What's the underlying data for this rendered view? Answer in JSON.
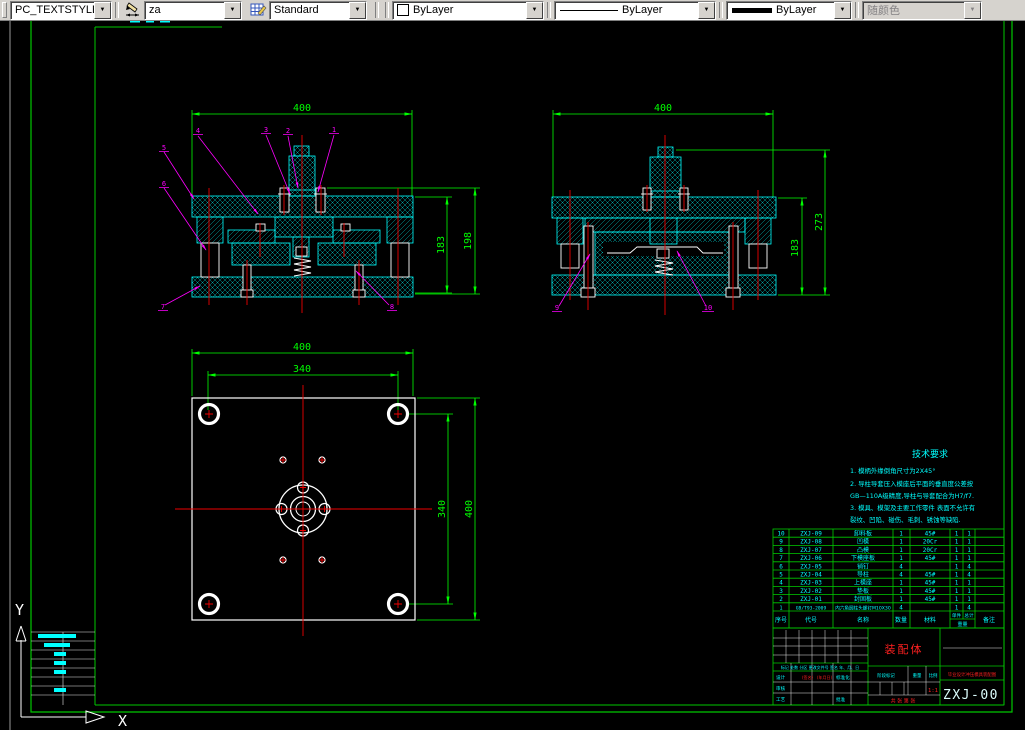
{
  "toolbar": {
    "text_style": {
      "value": "PC_TEXTSTYLE"
    },
    "dim_style": {
      "value": "za"
    },
    "table_style": {
      "value": "Standard"
    },
    "color": {
      "value": "ByLayer",
      "swatch": "#ffffff"
    },
    "linetype": {
      "value": "ByLayer"
    },
    "lineweight": {
      "value": "ByLayer"
    },
    "plot_style": {
      "value": "随颜色",
      "disabled": true
    },
    "arrow_glyph": "▼"
  },
  "ucs": {
    "x_label": "X",
    "y_label": "Y"
  },
  "colors": {
    "dim": "#00ff00",
    "geometry": "#00ffff",
    "center": "#ee0000",
    "leader": "#ff00ff",
    "table": "#00cc00",
    "title_red": "#ff2020"
  },
  "views": {
    "section_open": {
      "dim_top": "400",
      "dim_right_inner": "183",
      "dim_right_outer": "198",
      "leaders": [
        "1",
        "2",
        "3",
        "4",
        "5",
        "6",
        "7",
        "8"
      ]
    },
    "section_closed": {
      "dim_top": "400",
      "dim_right_inner": "183",
      "dim_right_outer": "273",
      "leaders": [
        "9",
        "10"
      ]
    },
    "plan": {
      "dim_top_outer": "400",
      "dim_top_inner": "340",
      "dim_right_inner": "340",
      "dim_right_outer": "400"
    }
  },
  "tech_requirements": {
    "title": "技术要求",
    "lines": [
      "1. 模柄外缘倒角尺寸为2X45°",
      "2. 导柱导套压入模座后平面的垂直度公差按",
      "   GB—110A级精度,导柱与导套配合为H7/f7.",
      "3. 模具、模架及主要工作零件 表面不允许有",
      "   裂纹、凹陷、碰伤、毛刺、锈蚀等缺陷."
    ]
  },
  "bom": {
    "headers": {
      "seq": "序号",
      "code": "代号",
      "name": "名称",
      "qty": "数量",
      "material": "材料",
      "weight": "重量",
      "unit": "单件",
      "total": "总计",
      "notes": "备注"
    },
    "rows": [
      {
        "seq": "10",
        "code": "ZXJ-09",
        "name": "卸料板",
        "qty": "1",
        "material": "45#",
        "unit": "1",
        "total": "1",
        "notes": ""
      },
      {
        "seq": "9",
        "code": "ZXJ-08",
        "name": "凹模",
        "qty": "1",
        "material": "20Cr",
        "unit": "1",
        "total": "1",
        "notes": ""
      },
      {
        "seq": "8",
        "code": "ZXJ-07",
        "name": "凸模",
        "qty": "1",
        "material": "20Cr",
        "unit": "1",
        "total": "1",
        "notes": ""
      },
      {
        "seq": "7",
        "code": "ZXJ-06",
        "name": "下模座板",
        "qty": "1",
        "material": "45#",
        "unit": "1",
        "total": "1",
        "notes": ""
      },
      {
        "seq": "6",
        "code": "ZXJ-05",
        "name": "销钉",
        "qty": "4",
        "material": "",
        "unit": "1",
        "total": "4",
        "notes": ""
      },
      {
        "seq": "5",
        "code": "ZXJ-04",
        "name": "导柱",
        "qty": "4",
        "material": "45#",
        "unit": "1",
        "total": "4",
        "notes": ""
      },
      {
        "seq": "4",
        "code": "ZXJ-03",
        "name": "上模座",
        "qty": "1",
        "material": "45#",
        "unit": "1",
        "total": "1",
        "notes": ""
      },
      {
        "seq": "3",
        "code": "ZXJ-02",
        "name": "垫板",
        "qty": "1",
        "material": "45#",
        "unit": "1",
        "total": "1",
        "notes": ""
      },
      {
        "seq": "2",
        "code": "ZXJ-01",
        "name": "封固板",
        "qty": "1",
        "material": "45#",
        "unit": "1",
        "total": "1",
        "notes": ""
      },
      {
        "seq": "1",
        "code": "GB/T93-2009",
        "name": "内六角圆柱头螺钉M10X30",
        "qty": "4",
        "material": "",
        "unit": "1",
        "total": "4",
        "notes": ""
      }
    ]
  },
  "title_block": {
    "part_name": "装配体",
    "drawing_no": "ZXJ-00",
    "scale": "1:1",
    "project": "毕业设计冲压模具装配图",
    "labels": {
      "row_marks": "标记 处数 分区 更改文件号 签名 年、月、日",
      "design": "设计",
      "sign": "(签名)",
      "date": "(年月日)",
      "standard": "标准化",
      "review": "审核",
      "process": "工艺",
      "approve": "批准",
      "stage_mark": "阶段标记",
      "weight": "重量",
      "ratio": "比例",
      "sheets": "共 张 第 张"
    }
  }
}
